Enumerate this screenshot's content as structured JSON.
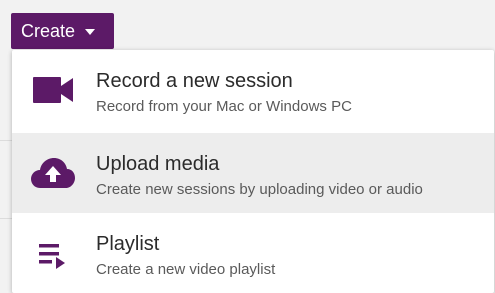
{
  "create_button": {
    "label": "Create",
    "caret_icon": "caret-down-icon"
  },
  "menu": {
    "items": [
      {
        "title": "Record a new session",
        "description": "Record from your Mac or Windows PC",
        "icon": "video-camera-icon"
      },
      {
        "title": "Upload media",
        "description": "Create new sessions by uploading video or audio",
        "icon": "cloud-upload-icon",
        "highlighted": true
      },
      {
        "title": "Playlist",
        "description": "Create a new video playlist",
        "icon": "playlist-icon"
      }
    ]
  },
  "colors": {
    "accent": "#5c1a67",
    "hover_background": "#ededed",
    "page_background": "#f2f2f2",
    "title_text": "#2b2b2b",
    "description_text": "#5a5a5a"
  }
}
